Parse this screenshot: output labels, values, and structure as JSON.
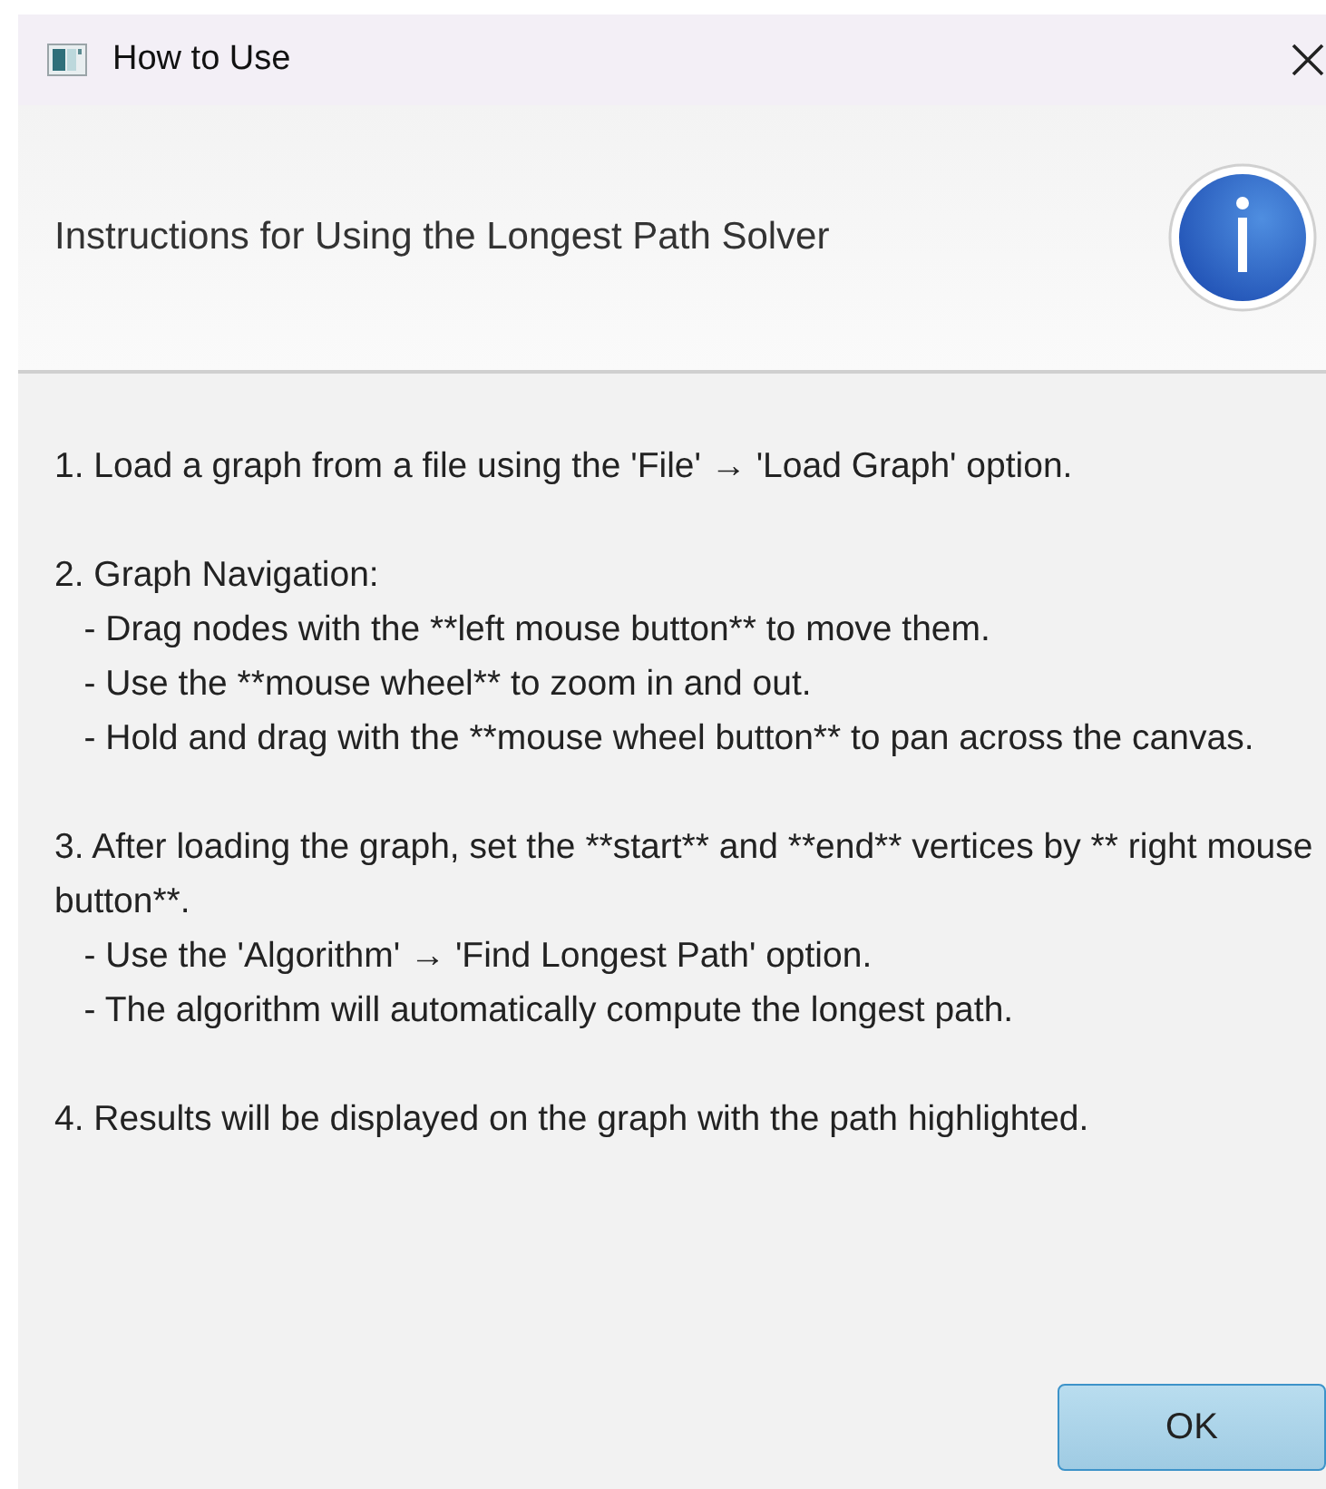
{
  "window": {
    "title": "How to Use"
  },
  "header": {
    "text": "Instructions for Using the Longest Path Solver"
  },
  "body": [
    [
      "1. Load a graph from a file using the 'File' → 'Load Graph' option."
    ],
    [
      "2. Graph Navigation:",
      "   - Drag nodes with the **left mouse button** to move them.",
      "   - Use the **mouse wheel** to zoom in and out.",
      "   - Hold and drag with the **mouse wheel button** to pan across the canvas."
    ],
    [
      "3. After loading the graph, set the **start** and **end** vertices by ** right mouse button**.",
      "   - Use the 'Algorithm' → 'Find Longest Path' option.",
      "   - The algorithm will automatically compute the longest path."
    ],
    [
      "4. Results will be displayed on the graph with the path highlighted."
    ]
  ],
  "buttons": [
    "OK"
  ]
}
